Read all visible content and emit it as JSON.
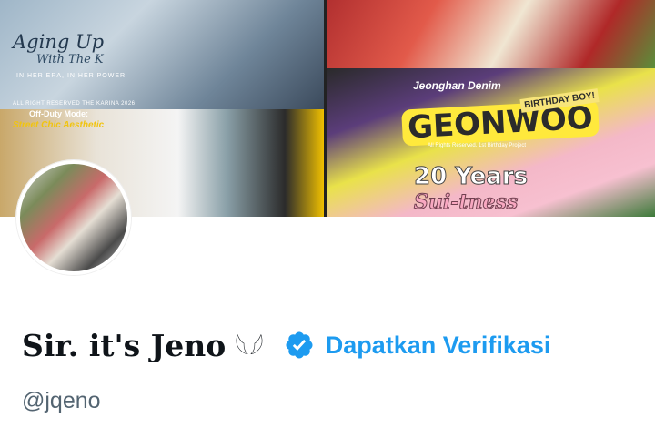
{
  "banner": {
    "panel1": {
      "title": "Aging Up",
      "subtitle": "With The K",
      "tagline": "IN HER ERA, IN HER POWER",
      "footer": "ALL RIGHT RESERVED THE KARINA 2026"
    },
    "panel3": {
      "label": "Off-Duty Mode:",
      "title": "Street Chic Aesthetic"
    },
    "panel4": {
      "heading": "Jeonghan Denim",
      "main_text": "GEONWOO",
      "mark_text": "MARK",
      "birthday_text": "BIRTHDAY BOY!",
      "footer": "All Rights Reserved. 1st Birthday Project",
      "years_text": "20 Years",
      "sub_text": "Sui-tness"
    }
  },
  "profile": {
    "display_name": "Sir. it's Jeno",
    "name_emoji": "𓆩𓆪",
    "verify_cta": "Dapatkan Verifikasi",
    "handle": "@jqeno"
  },
  "colors": {
    "accent": "#1d9bf0",
    "text_primary": "#0f1419",
    "text_secondary": "#536471"
  },
  "icons": {
    "verify": "verified-badge-icon"
  }
}
